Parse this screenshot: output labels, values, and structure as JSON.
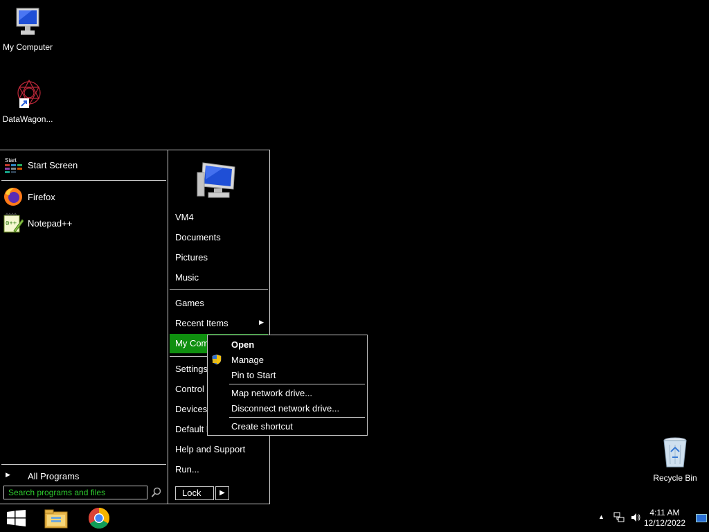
{
  "desktop": {
    "icons": [
      {
        "label": "My Computer"
      },
      {
        "label": "DataWagon..."
      },
      {
        "label": "Recycle Bin"
      }
    ]
  },
  "start_menu": {
    "pinned": [
      {
        "label": "Start Screen",
        "icon": "start-screen-icon"
      },
      {
        "label": "Firefox",
        "icon": "firefox-icon"
      },
      {
        "label": "Notepad++",
        "icon": "notepad-plus-plus-icon"
      }
    ],
    "all_programs": "All Programs",
    "search_placeholder": "Search programs and files",
    "right": {
      "user": "VM4",
      "documents": "Documents",
      "pictures": "Pictures",
      "music": "Music",
      "games": "Games",
      "recent_items": "Recent Items",
      "my_computer": "My Com",
      "settings": "Settings",
      "control_panel": "Control P",
      "devices": "Devices a",
      "default_programs": "Default P",
      "help": "Help and Support",
      "run": "Run..."
    },
    "lock": "Lock"
  },
  "context_menu": {
    "open": "Open",
    "manage": "Manage",
    "pin": "Pin to Start",
    "map_drive": "Map network drive...",
    "disconnect_drive": "Disconnect network drive...",
    "create_shortcut": "Create shortcut"
  },
  "taskbar": {
    "time": "4:11 AM",
    "date": "12/12/2022"
  },
  "colors": {
    "highlight": "#0f8f0f",
    "search_text": "#2ecc2e"
  }
}
